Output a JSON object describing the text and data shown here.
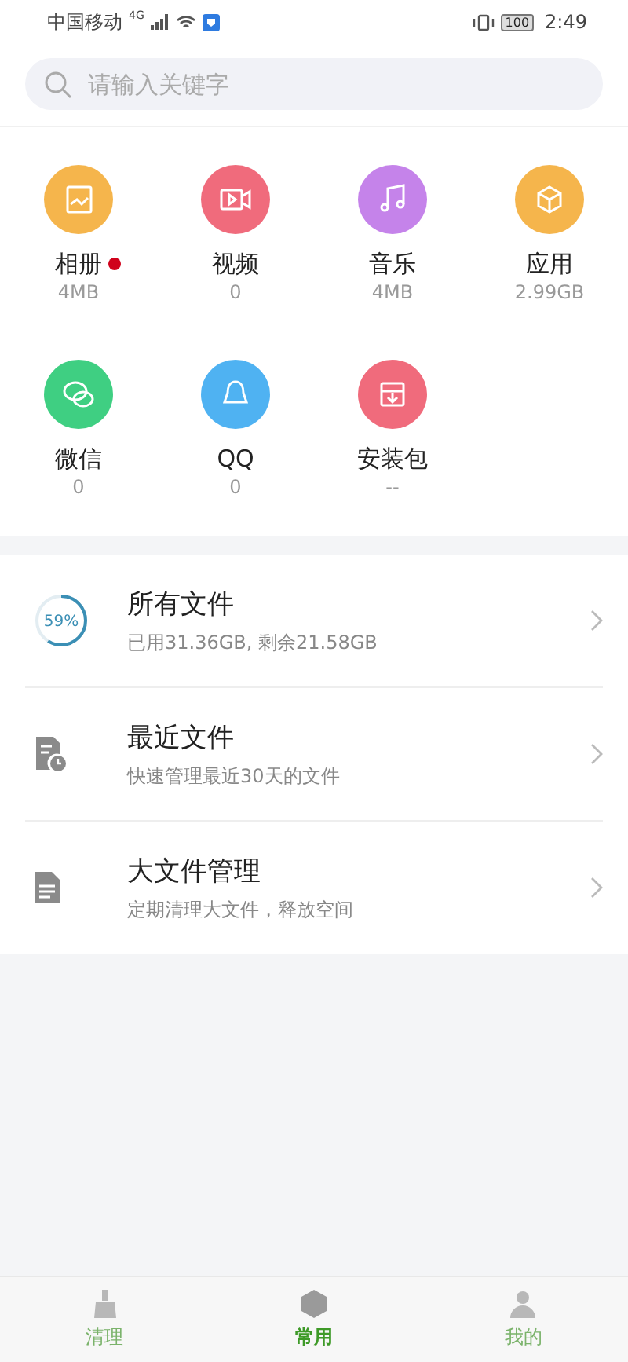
{
  "status_bar": {
    "carrier": "中国移动",
    "network": "4G",
    "battery": "100",
    "time": "2:49"
  },
  "search": {
    "placeholder": "请输入关键字"
  },
  "categories": [
    {
      "kind": "photo",
      "label": "相册",
      "size": "4MB",
      "color": "#f5b54c",
      "badge": true
    },
    {
      "kind": "video",
      "label": "视频",
      "size": "0",
      "color": "#f06b7c",
      "badge": false
    },
    {
      "kind": "music",
      "label": "音乐",
      "size": "4MB",
      "color": "#c583ea",
      "badge": false
    },
    {
      "kind": "app",
      "label": "应用",
      "size": "2.99GB",
      "color": "#f5b54c",
      "badge": false
    },
    {
      "kind": "chat",
      "label": "微信",
      "size": "0",
      "color": "#3fcf82",
      "badge": false
    },
    {
      "kind": "penguin",
      "label": "QQ",
      "size": "0",
      "color": "#4fb2f2",
      "badge": false
    },
    {
      "kind": "package",
      "label": "安装包",
      "size": "--",
      "color": "#f06b7c",
      "badge": false
    }
  ],
  "files": [
    {
      "kind": "storage",
      "title": "所有文件",
      "subtitle": "已用31.36GB, 剩余21.58GB",
      "percent": "59%",
      "level": 0.59
    },
    {
      "kind": "recent",
      "title": "最近文件",
      "subtitle": "快速管理最近30天的文件"
    },
    {
      "kind": "large",
      "title": "大文件管理",
      "subtitle": "定期清理大文件，释放空间"
    }
  ],
  "tabs": [
    {
      "kind": "clean",
      "label": "清理",
      "selected": false
    },
    {
      "kind": "common",
      "label": "常用",
      "selected": true
    },
    {
      "kind": "mine",
      "label": "我的",
      "selected": false
    }
  ]
}
